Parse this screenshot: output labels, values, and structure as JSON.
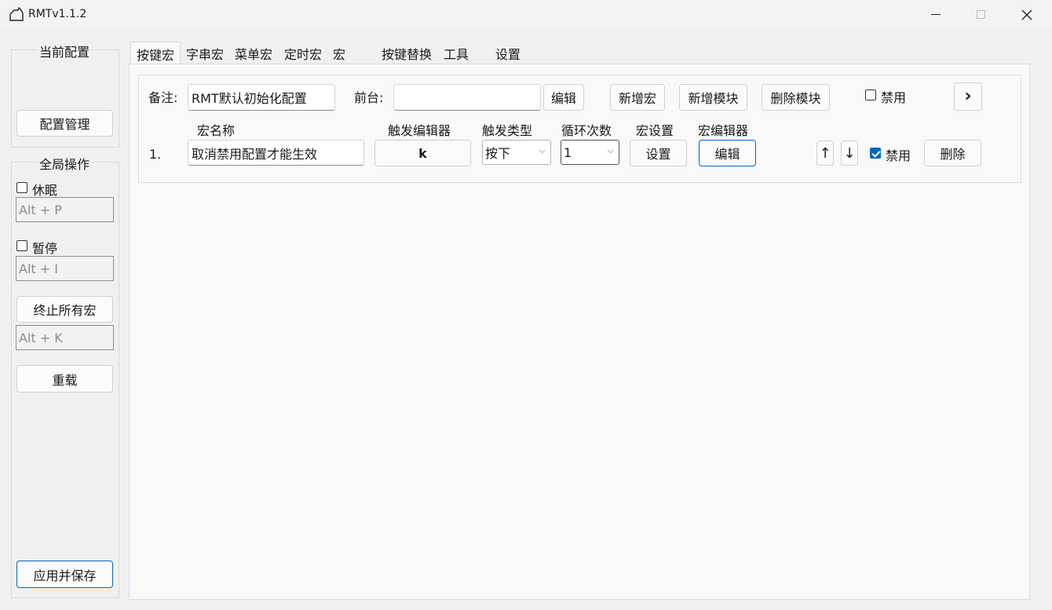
{
  "window": {
    "title": "RMTv1.1.2"
  },
  "sidebar": {
    "current_config_label": "当前配置",
    "config_manage_label": "配置管理",
    "global_ops_label": "全局操作",
    "sleep_label": "休眠",
    "sleep_hotkey": "Alt + P",
    "pause_label": "暂停",
    "pause_hotkey": "Alt + I",
    "stop_all_label": "终止所有宏",
    "stop_all_hotkey": "Alt + K",
    "reload_label": "重载",
    "apply_save_label": "应用并保存"
  },
  "tabs": [
    "按键宏",
    "字串宏",
    "菜单宏",
    "定时宏",
    "宏",
    "按键替换",
    "工具",
    "设置"
  ],
  "module": {
    "note_label": "备注:",
    "note_value": "RMT默认初始化配置",
    "foreground_label": "前台:",
    "foreground_value": "",
    "edit_label": "编辑",
    "add_macro_label": "新增宏",
    "add_module_label": "新增模块",
    "delete_module_label": "删除模块",
    "disable_label": "禁用",
    "disable_checked": false,
    "expand_label": "›"
  },
  "columns": {
    "name": "宏名称",
    "trigger_editor": "触发编辑器",
    "trigger_type": "触发类型",
    "loop_count": "循环次数",
    "macro_settings": "宏设置",
    "macro_editor": "宏编辑器"
  },
  "rows": [
    {
      "index": "1.",
      "name": "取消禁用配置才能生效",
      "trigger_key": "k",
      "trigger_type": "按下",
      "loop_count": "1",
      "settings_label": "设置",
      "editor_label": "编辑",
      "up_label": "↑",
      "down_label": "↓",
      "disable_label": "禁用",
      "disable_checked": true,
      "delete_label": "删除"
    }
  ]
}
